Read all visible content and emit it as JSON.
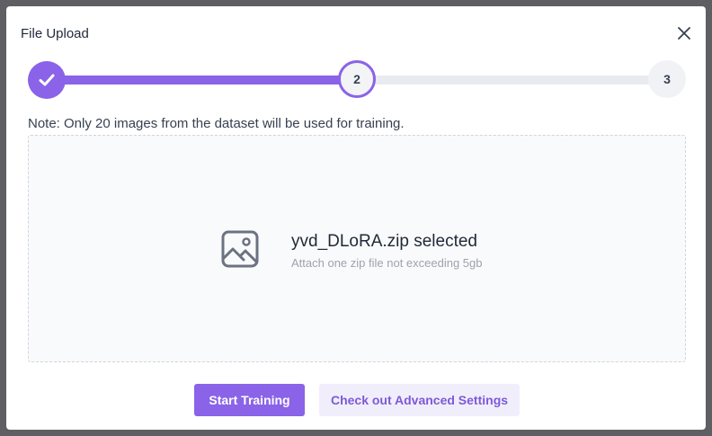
{
  "dialog": {
    "title": "File Upload"
  },
  "stepper": {
    "steps": [
      {
        "label": "",
        "status": "complete"
      },
      {
        "label": "2",
        "status": "current"
      },
      {
        "label": "3",
        "status": "upcoming"
      }
    ],
    "accent_color": "#8a63e8"
  },
  "note": "Note: Only 20 images from the dataset will be used for training.",
  "dropzone": {
    "icon": "image-icon",
    "file_status": "yvd_DLoRA.zip selected",
    "hint": "Attach one zip file not exceeding 5gb"
  },
  "actions": {
    "primary_label": "Start Training",
    "secondary_label": "Check out Advanced Settings"
  }
}
